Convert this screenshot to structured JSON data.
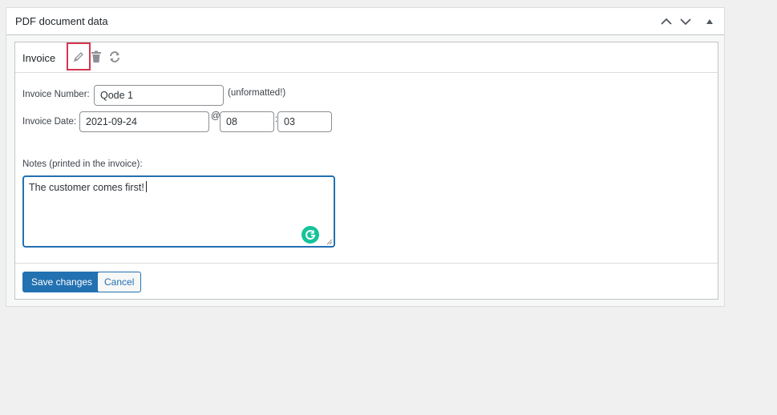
{
  "postbox": {
    "title": "PDF document data",
    "actions": [
      "move-up",
      "move-down",
      "toggle-panel"
    ]
  },
  "document": {
    "title": "Invoice",
    "icons": {
      "edit": "pencil-icon",
      "delete": "trash-icon",
      "regenerate": "refresh-icon"
    },
    "fields": {
      "invoice_number_label": "Invoice Number:",
      "invoice_number_value": "Qode 1",
      "invoice_number_note": "(unformatted!)",
      "invoice_date_label": "Invoice Date:",
      "invoice_date_value": "2021-09-24",
      "at_symbol": "@",
      "hour_value": "08",
      "time_separator": ":",
      "minute_value": "03",
      "notes_label": "Notes (printed in the invoice):",
      "notes_value": "The customer comes first!"
    },
    "buttons": {
      "save": "Save changes",
      "cancel": "Cancel"
    }
  },
  "colors": {
    "accent": "#2271b1",
    "highlight": "#d63651",
    "grammarly": "#15c39a"
  }
}
